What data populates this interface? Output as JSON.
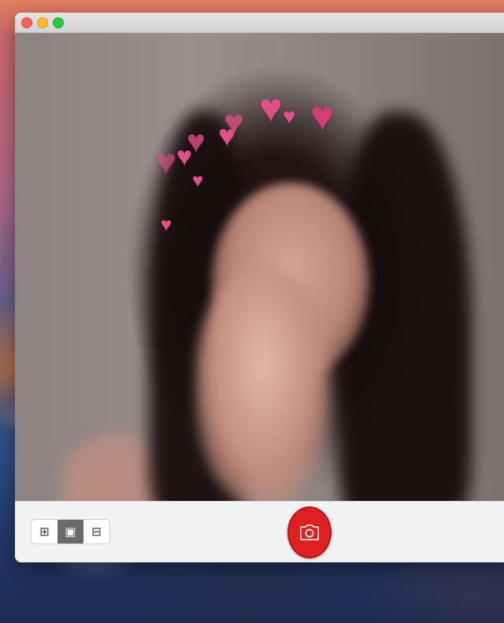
{
  "window": {
    "traffic_lights": [
      "close",
      "minimize",
      "maximize"
    ]
  },
  "preview": {
    "effect": "heart-crown",
    "heart_color": "#e0508a"
  },
  "toolbar": {
    "layout_buttons": [
      {
        "icon": "grid-icon",
        "glyph": "⊞",
        "active": false
      },
      {
        "icon": "single-frame-icon",
        "glyph": "▣",
        "active": true
      },
      {
        "icon": "film-strip-icon",
        "glyph": "⊟",
        "active": false
      }
    ],
    "shutter": {
      "icon": "camera-icon",
      "color": "#e02020"
    }
  }
}
